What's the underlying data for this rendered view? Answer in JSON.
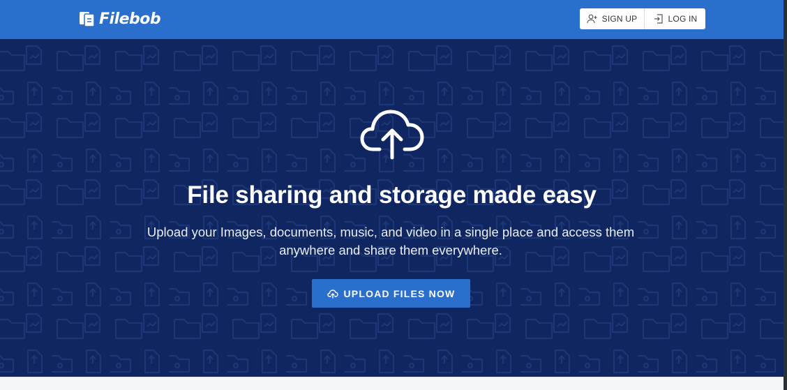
{
  "header": {
    "brand": "Filebob",
    "signup_label": "SIGN UP",
    "login_label": "LOG IN"
  },
  "hero": {
    "title": "File sharing and storage made easy",
    "subtitle_line1": "Upload your Images, documents, music, and video in a single place and access them",
    "subtitle_line2": "anywhere and share them everywhere.",
    "cta_label": "UPLOAD FILES NOW"
  },
  "icons": {
    "brand": "filebob-logo-icon",
    "signup": "user-plus-icon",
    "login": "login-icon",
    "hero": "cloud-upload-icon",
    "cta": "cloud-upload-icon"
  },
  "colors": {
    "primary": "#2b6fcd",
    "hero_bg": "#0f2660",
    "text_light": "#ffffff"
  }
}
